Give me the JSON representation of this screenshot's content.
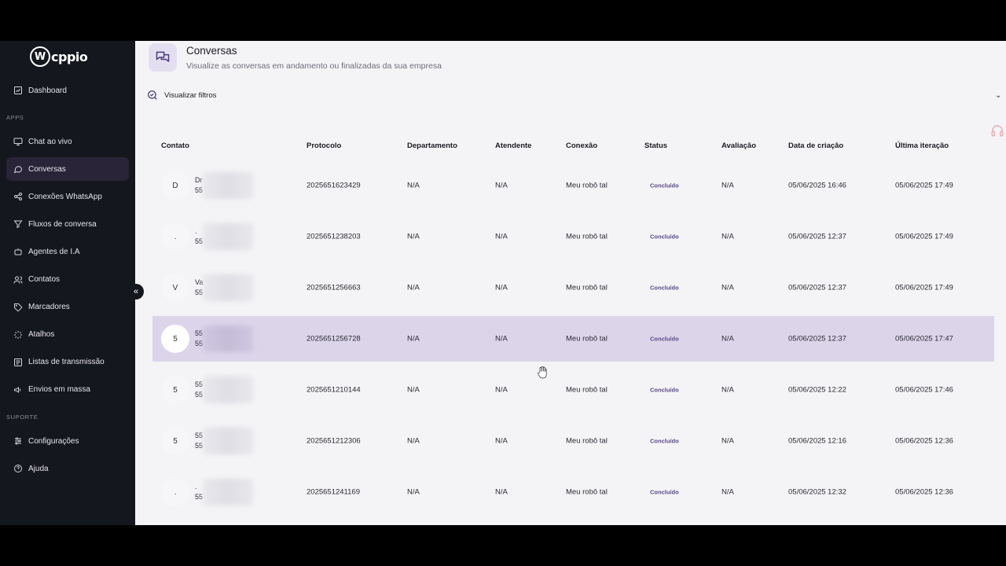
{
  "brand": {
    "logo_letter": "W",
    "logo_text": "cppio"
  },
  "sidebar": {
    "top_item": {
      "label": "Dashboard",
      "icon": "dashboard-icon"
    },
    "section_apps": "APPS",
    "apps": [
      {
        "label": "Chat ao vivo",
        "icon": "monitor-icon"
      },
      {
        "label": "Conversas",
        "icon": "chat-icon",
        "active": true
      },
      {
        "label": "Conexões WhatsApp",
        "icon": "share-icon"
      },
      {
        "label": "Fluxos de conversa",
        "icon": "funnel-icon"
      },
      {
        "label": "Agentes de I.A",
        "icon": "bot-icon"
      },
      {
        "label": "Contatos",
        "icon": "users-icon"
      },
      {
        "label": "Marcadores",
        "icon": "tag-icon"
      },
      {
        "label": "Atalhos",
        "icon": "zap-icon"
      },
      {
        "label": "Listas de transmissão",
        "icon": "list-icon"
      },
      {
        "label": "Envios em massa",
        "icon": "megaphone-icon"
      }
    ],
    "section_support": "SUPORTE",
    "support": [
      {
        "label": "Configurações",
        "icon": "sliders-icon"
      },
      {
        "label": "Ajuda",
        "icon": "help-icon"
      }
    ],
    "collapse_glyph": "«"
  },
  "header": {
    "title": "Conversas",
    "subtitle": "Visualize as conversas em andamento ou finalizadas da sua empresa"
  },
  "filters": {
    "label": "Visualizar filtros",
    "chevron": "⌄"
  },
  "table": {
    "columns": [
      "Contato",
      "Protocolo",
      "Departamento",
      "Atendente",
      "Conexão",
      "Status",
      "Avaliação",
      "Data de criação",
      "Última iteração"
    ],
    "rows": [
      {
        "initial": "D",
        "name1": "Dr",
        "name2": "55",
        "protocolo": "2025651623429",
        "departamento": "N/A",
        "atendente": "N/A",
        "conexao": "Meu robô tal",
        "status": "Concluído",
        "avaliacao": "N/A",
        "criacao": "05/06/2025 16:46",
        "iteracao": "05/06/2025 17:49",
        "highlighted": false
      },
      {
        "initial": ".",
        "name1": ".",
        "name2": "55",
        "protocolo": "2025651238203",
        "departamento": "N/A",
        "atendente": "N/A",
        "conexao": "Meu robô tal",
        "status": "Concluído",
        "avaliacao": "N/A",
        "criacao": "05/06/2025 12:37",
        "iteracao": "05/06/2025 17:49",
        "highlighted": false
      },
      {
        "initial": "V",
        "name1": "Va",
        "name2": "55",
        "protocolo": "2025651256663",
        "departamento": "N/A",
        "atendente": "N/A",
        "conexao": "Meu robô tal",
        "status": "Concluído",
        "avaliacao": "N/A",
        "criacao": "05/06/2025 12:37",
        "iteracao": "05/06/2025 17:49",
        "highlighted": false
      },
      {
        "initial": "5",
        "name1": "55",
        "name2": "55",
        "protocolo": "2025651256728",
        "departamento": "N/A",
        "atendente": "N/A",
        "conexao": "Meu robô tal",
        "status": "Concluído",
        "avaliacao": "N/A",
        "criacao": "05/06/2025 12:37",
        "iteracao": "05/06/2025 17:47",
        "highlighted": true
      },
      {
        "initial": "5",
        "name1": "55",
        "name2": "55",
        "protocolo": "2025651210144",
        "departamento": "N/A",
        "atendente": "N/A",
        "conexao": "Meu robô tal",
        "status": "Concluído",
        "avaliacao": "N/A",
        "criacao": "05/06/2025 12:22",
        "iteracao": "05/06/2025 17:46",
        "highlighted": false
      },
      {
        "initial": "5",
        "name1": "55",
        "name2": "55",
        "protocolo": "2025651212306",
        "departamento": "N/A",
        "atendente": "N/A",
        "conexao": "Meu robô tal",
        "status": "Concluído",
        "avaliacao": "N/A",
        "criacao": "05/06/2025 12:16",
        "iteracao": "05/06/2025 12:36",
        "highlighted": false
      },
      {
        "initial": ".",
        "name1": ".",
        "name2": "55",
        "protocolo": "2025651241169",
        "departamento": "N/A",
        "atendente": "N/A",
        "conexao": "Meu robô tal",
        "status": "Concluído",
        "avaliacao": "N/A",
        "criacao": "05/06/2025 12:32",
        "iteracao": "05/06/2025 12:36",
        "highlighted": false
      }
    ]
  },
  "colors": {
    "sidebar_bg": "#15171e",
    "active_item": "#2a2438",
    "highlight_row": "#dcd5ea",
    "status": "#5a4a86"
  }
}
